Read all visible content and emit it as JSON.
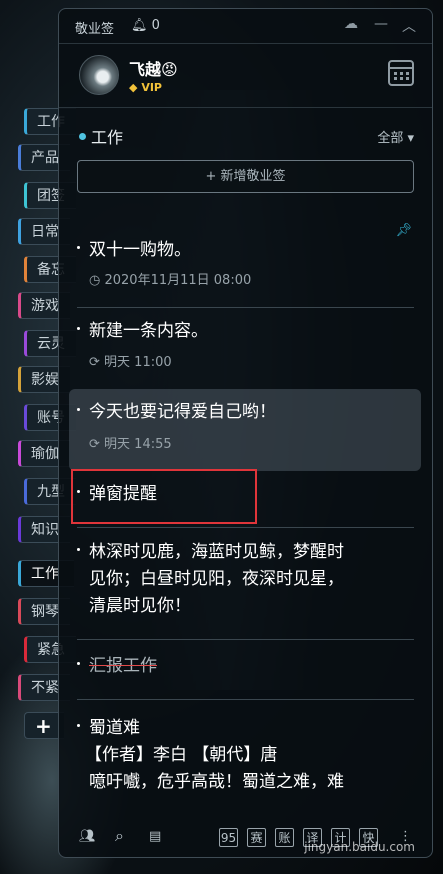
{
  "titlebar": {
    "app_name": "敬业签",
    "notification_count": "0",
    "icons": [
      "cloud-sync-icon",
      "minus-icon",
      "collapse-up-icon"
    ]
  },
  "user": {
    "name": "飞越😡",
    "badge": "VIP"
  },
  "side_tabs": [
    {
      "label": "工作",
      "color": "#3aa8d8"
    },
    {
      "label": "产品",
      "color": "#4a7dd9"
    },
    {
      "label": "团签",
      "color": "#3ec4d4"
    },
    {
      "label": "日常",
      "color": "#3fa2e0"
    },
    {
      "label": "备忘",
      "color": "#e0833a"
    },
    {
      "label": "游戏",
      "color": "#d94a8a"
    },
    {
      "label": "云灵",
      "color": "#9a4ad9"
    },
    {
      "label": "影娱",
      "color": "#d4a23a"
    },
    {
      "label": "账号",
      "color": "#6a4ad9"
    },
    {
      "label": "瑜伽",
      "color": "#c94ad9"
    },
    {
      "label": "九型",
      "color": "#4a6ad9"
    },
    {
      "label": "知识",
      "color": "#6a3ad9"
    },
    {
      "label": "工作",
      "color": "#3aa8d8",
      "active": true
    },
    {
      "label": "钢琴",
      "color": "#d94a5a"
    },
    {
      "label": "紧急",
      "color": "#d92a3a"
    },
    {
      "label": "不紧",
      "color": "#d94a7a"
    }
  ],
  "add_tab": "+",
  "category": {
    "title": "工作",
    "filter": "全部 ▾",
    "add_button": "+ 新增敬业签"
  },
  "notes": [
    {
      "text": "双十一购物。",
      "meta": "2020年11月11日 08:00",
      "icon": "clock-icon",
      "pinned": true
    },
    {
      "text": "新建一条内容。",
      "meta": "明天 11:00",
      "icon": "repeat-icon"
    },
    {
      "text": "今天也要记得爱自己哟！",
      "meta": "明天 14:55",
      "icon": "repeat-icon",
      "highlighted": true
    },
    {
      "text": "弹窗提醒"
    },
    {
      "lines": [
        "林深时见鹿，海蓝时见鲸，梦醒时",
        "见你；白昼时见阳，夜深时见星，",
        "清晨时见你！"
      ]
    },
    {
      "text": "汇报工作",
      "done": true
    },
    {
      "lines": [
        "蜀道难",
        "【作者】李白 【朝代】唐",
        "噫吁嚱，危乎高哉！蜀道之难，难"
      ]
    }
  ],
  "bottombar": {
    "icons": [
      "contacts-icon",
      "search-icon",
      "notes-icon"
    ],
    "buttons": [
      "95",
      "赛",
      "账",
      "译",
      "计",
      "快"
    ],
    "more": "⋮"
  },
  "watermark": "jingyan.baidu.com"
}
